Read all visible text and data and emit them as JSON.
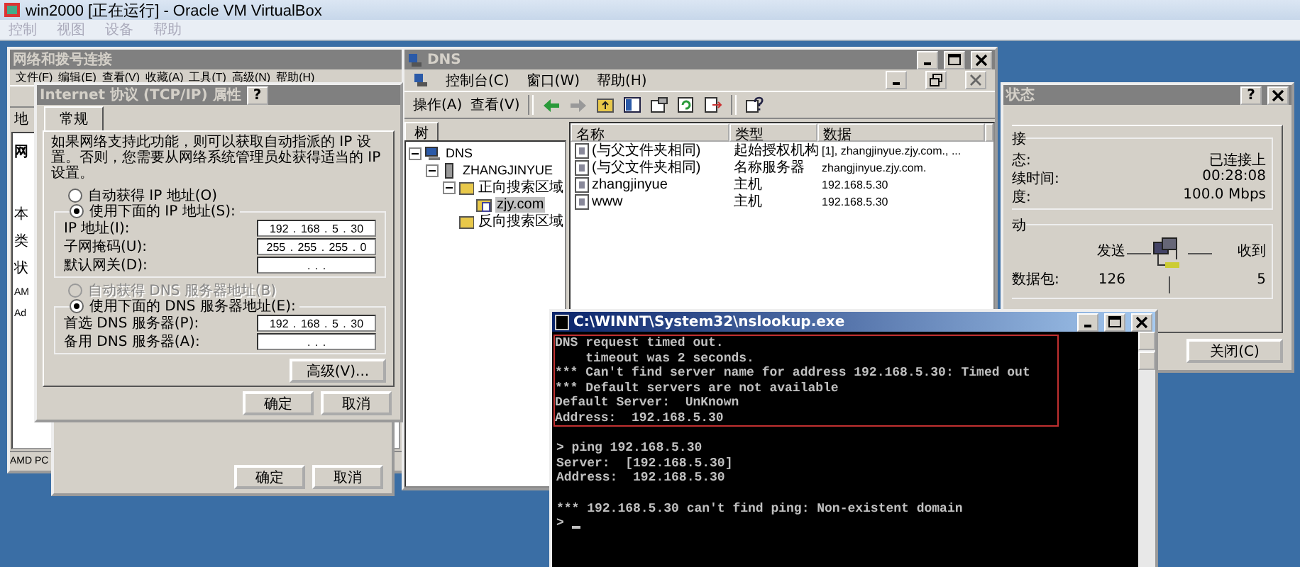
{
  "vm": {
    "title": "win2000 [正在运行] - Oracle VM VirtualBox",
    "menu": [
      "控制",
      "视图",
      "设备",
      "帮助"
    ]
  },
  "net_window": {
    "title": "网络和拨号连接",
    "menu": [
      "文件(F)",
      "编辑(E)",
      "查看(V)",
      "收藏(A)",
      "工具(T)",
      "高级(N)",
      "帮助(H)"
    ],
    "address_label": "地",
    "side_texts": [
      "网",
      "本",
      "类",
      "状",
      "AM",
      "Ad"
    ],
    "status_text": "AMD PC"
  },
  "props_dialog": {
    "buttons": [
      "确定",
      "取消"
    ]
  },
  "tcpip_dialog": {
    "title": "Internet 协议 (TCP/IP) 属性",
    "help_button": "?",
    "tab": "常规",
    "intro": "如果网络支持此功能，则可以获取自动指派的 IP 设置。否则，您需要从网络系统管理员处获得适当的 IP 设置。",
    "ip_auto": {
      "label": "自动获得 IP 地址(O)",
      "selected": false,
      "disabled": false
    },
    "ip_manual": {
      "label": "使用下面的 IP 地址(S):",
      "selected": true,
      "disabled": false
    },
    "ip_fields": [
      {
        "label": "IP 地址(I):",
        "value": "192 . 168 . 5 . 30"
      },
      {
        "label": "子网掩码(U):",
        "value": "255 . 255 . 255 . 0"
      },
      {
        "label": "默认网关(D):",
        "value": ". . ."
      }
    ],
    "dns_auto": {
      "label": "自动获得 DNS 服务器地址(B)",
      "selected": false,
      "disabled": true
    },
    "dns_manual": {
      "label": "使用下面的 DNS 服务器地址(E):",
      "selected": true,
      "disabled": false
    },
    "dns_fields": [
      {
        "label": "首选 DNS 服务器(P):",
        "value": "192 . 168 . 5 . 30"
      },
      {
        "label": "备用 DNS 服务器(A):",
        "value": ". . ."
      }
    ],
    "advanced_button": "高级(V)...",
    "buttons": [
      "确定",
      "取消"
    ]
  },
  "dns_window": {
    "title": "DNS",
    "menu": [
      "控制台(C)",
      "窗口(W)",
      "帮助(H)"
    ],
    "actions": [
      "操作(A)",
      "查看(V)"
    ],
    "tree_tab": "树",
    "tree": [
      {
        "label": "DNS",
        "kind": "root",
        "expanded": true,
        "selected": false,
        "children": [
          {
            "label": "ZHANGJINYUE",
            "kind": "server",
            "expanded": true,
            "selected": false,
            "children": [
              {
                "label": "正向搜索区域",
                "kind": "folder",
                "expanded": true,
                "selected": false,
                "children": [
                  {
                    "label": "zjy.com",
                    "kind": "zone",
                    "selected": true
                  }
                ]
              },
              {
                "label": "反向搜索区域",
                "kind": "folder",
                "selected": false
              }
            ]
          }
        ]
      }
    ],
    "columns": [
      "名称",
      "类型",
      "数据"
    ],
    "rows": [
      {
        "name": "(与父文件夹相同)",
        "type": "起始授权机构",
        "data": "[1], zhangjinyue.zjy.com., ..."
      },
      {
        "name": "(与父文件夹相同)",
        "type": "名称服务器",
        "data": "zhangjinyue.zjy.com."
      },
      {
        "name": "zhangjinyue",
        "type": "主机",
        "data": "192.168.5.30"
      },
      {
        "name": "www",
        "type": "主机",
        "data": "192.168.5.30"
      }
    ]
  },
  "status_window": {
    "title": "状态",
    "help_button": "?",
    "connection_group": "接",
    "rows": [
      {
        "label": "态:",
        "value": "已连接上"
      },
      {
        "label": "续时间:",
        "value": "00:28:08"
      },
      {
        "label": "度:",
        "value": "100.0 Mbps"
      }
    ],
    "activity_group": "动",
    "sent_label": "发送",
    "received_label": "收到",
    "packets_label": "数据包:",
    "sent": "126",
    "received": "5",
    "close_button": "关闭(C)"
  },
  "console": {
    "title": "C:\\WINNT\\System32\\nslookup.exe",
    "blocks": [
      {
        "highlighted": true,
        "lines": [
          "DNS request timed out.",
          "    timeout was 2 seconds.",
          "*** Can't find server name for address 192.168.5.30: Timed out",
          "*** Default servers are not available",
          "Default Server:  UnKnown",
          "Address:  192.168.5.30"
        ]
      },
      {
        "highlighted": false,
        "lines": [
          "> ping 192.168.5.30",
          "Server:  [192.168.5.30]",
          "Address:  192.168.5.30"
        ]
      },
      {
        "highlighted": false,
        "lines": [
          "*** 192.168.5.30 can't find ping: Non-existent domain",
          ">"
        ]
      }
    ]
  }
}
